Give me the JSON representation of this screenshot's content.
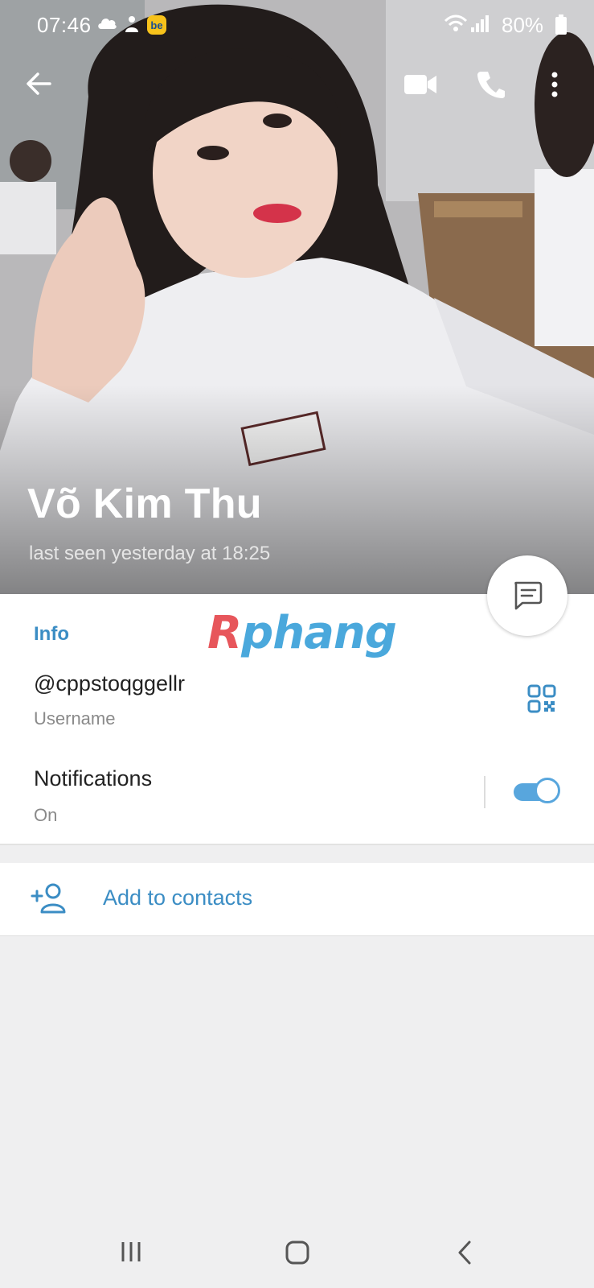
{
  "status_bar": {
    "time": "07:46",
    "battery_percent": "80%",
    "icons": [
      "cloud-icon",
      "app-notification-icon",
      "be-app-icon",
      "wifi-icon",
      "signal-icon",
      "battery-icon"
    ]
  },
  "toolbar": {
    "icons": [
      "back-arrow-icon",
      "video-call-icon",
      "phone-call-icon",
      "more-vert-icon"
    ]
  },
  "profile": {
    "name": "Võ Kim Thu",
    "last_seen": "last seen yesterday at 18:25"
  },
  "info": {
    "section_title": "Info",
    "watermark_part1": "R",
    "watermark_part2": "phang",
    "username": "@cppstoqggellr",
    "username_label": "Username",
    "notifications_title": "Notifications",
    "notifications_value": "On",
    "notifications_enabled": true
  },
  "actions": {
    "add_to_contacts": "Add to contacts"
  },
  "colors": {
    "accent": "#3b8dc4",
    "toggle": "#58a6dd",
    "background": "#efeff0"
  },
  "nav_bar": {
    "icons": [
      "recent-apps-icon",
      "home-icon",
      "back-nav-icon"
    ]
  }
}
